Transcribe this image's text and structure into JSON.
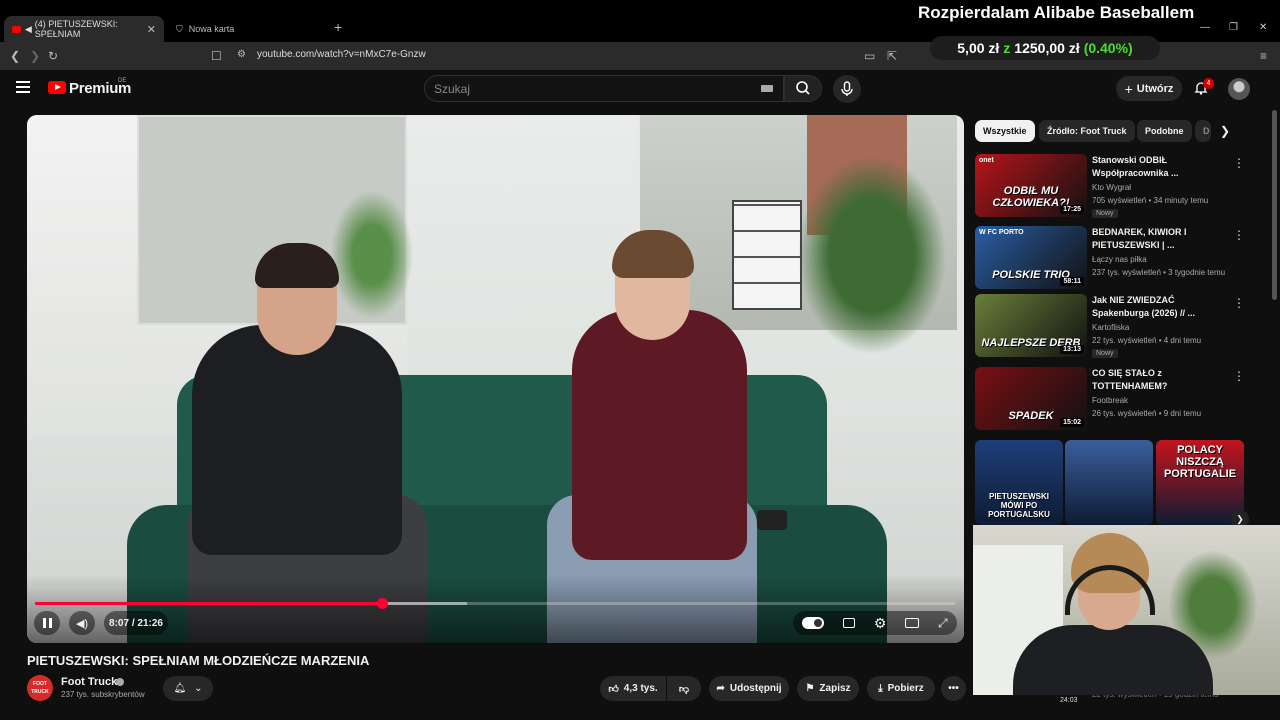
{
  "browser": {
    "tabs": [
      {
        "label": "(4) PIETUSZEWSKI: SPEŁNIAM",
        "active": true
      },
      {
        "label": "Nowa karta",
        "active": false
      }
    ],
    "new_tab": "+",
    "url": "youtube.com/watch?v=nMxC7e-Gnzw"
  },
  "stream_overlay": {
    "title": "Rozpierdalam Alibabe Baseballem",
    "price_from": "5,00 zł",
    "price_sep": "z",
    "price_to": "1250,00 zł",
    "percent": "(0.40%)"
  },
  "header": {
    "logo_text": "Premium",
    "logo_region": "DE",
    "search_placeholder": "Szukaj",
    "create_label": "Utwórz",
    "notification_count": "4"
  },
  "player": {
    "current_time": "8:07 / 21:26",
    "progress_fraction": 0.377,
    "buffer_fraction": 0.47
  },
  "video": {
    "title": "PIETUSZEWSKI: SPEŁNIAM MŁODZIEŃCZE MARZENIA",
    "channel": "Foot Truck",
    "channel_avatar_text": "FOOT TRUCK",
    "subscribers": "237 tys. subskrybentów",
    "likes": "4,3 tys.",
    "share_label": "Udostępnij",
    "save_label": "Zapisz",
    "download_label": "Pobierz"
  },
  "sidebar": {
    "chips": [
      "Wszystkie",
      "Źródło: Foot Truck",
      "Podobne",
      "D"
    ],
    "recommendations": [
      {
        "title": "Stanowski ODBIŁ Współpracownika ...",
        "channel": "Kto Wygrał",
        "meta": "705 wyświetleń • 34 minuty temu",
        "duration": "17:25",
        "badge": "Nowy",
        "thumb_text": "ODBIŁ MU CZŁOWIEKA?!",
        "thumb_color": "#b8141a",
        "thumb_label": "onet"
      },
      {
        "title": "BEDNAREK, KIWIOR I PIETUSZEWSKI | ...",
        "channel": "Łączy nas piłka",
        "meta": "237 tys. wyświetleń • 3 tygodnie temu",
        "duration": "58:11",
        "badge": "",
        "thumb_text": "POLSKIE TRIO",
        "thumb_color": "#2a5ea6",
        "thumb_label": "W FC PORTO"
      },
      {
        "title": "Jak NIE ZWIEDZAĆ Spakenburga (2026) // ...",
        "channel": "Kartofliska",
        "meta": "22 tys. wyświetleń • 4 dni temu",
        "duration": "13:13",
        "badge": "Nowy",
        "thumb_text": "NAJLEPSZE  DERB",
        "thumb_color": "#6a7f3a",
        "thumb_label": ""
      },
      {
        "title": "CO SIĘ STAŁO z TOTTENHAMEM?",
        "channel": "Footbreak",
        "meta": "26 tys. wyświetleń • 9 dni temu",
        "duration": "15:02",
        "badge": "",
        "thumb_text": "SPADEK",
        "thumb_color": "#7a0f14",
        "thumb_label": ""
      }
    ],
    "shorts": [
      {
        "text": "PIETUSZEWSKI MÓWI PO PORTUGALSKU",
        "color": "#1f3f7a"
      },
      {
        "text": "",
        "color": "#3b5f9c"
      },
      {
        "text": "POLACY NISZCZĄ PORTUGALIE",
        "color": "#c4141c"
      }
    ],
    "hidden_meta": "22 tys. wyświetleń • 19 godzin temu",
    "hidden_duration": "24:03"
  }
}
